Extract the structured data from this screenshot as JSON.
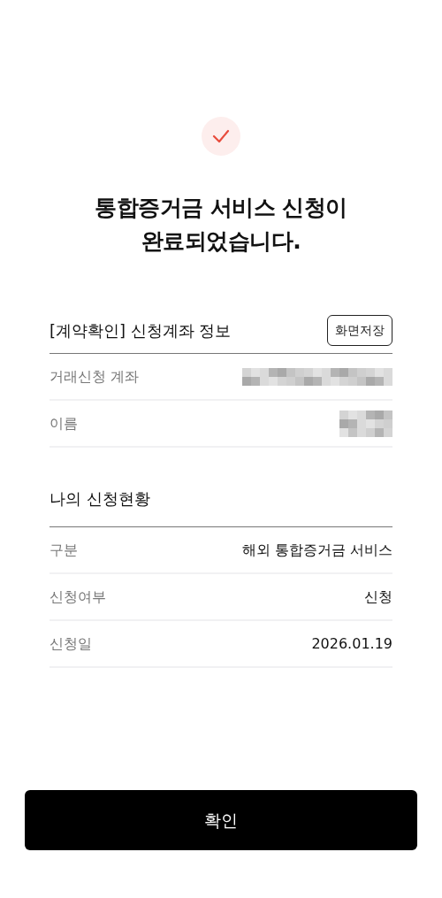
{
  "title": "통합증거금 서비스 신청이\n완료되었습니다.",
  "sections": [
    {
      "heading": "[계약확인] 신청계좌 정보",
      "action": "화면저장",
      "rows": [
        {
          "label": "거래신청 계좌",
          "kind": "masked"
        },
        {
          "label": "이름",
          "kind": "masked_short"
        }
      ]
    },
    {
      "heading": "나의 신청현황",
      "rows": [
        {
          "label": "구분",
          "kind": "text",
          "value": "해외 통합증거금 서비스"
        },
        {
          "label": "신청여부",
          "kind": "text",
          "value": "신청"
        },
        {
          "label": "신청일",
          "kind": "text",
          "value": "2026.01.19"
        }
      ]
    }
  ],
  "confirm_button": "확인"
}
